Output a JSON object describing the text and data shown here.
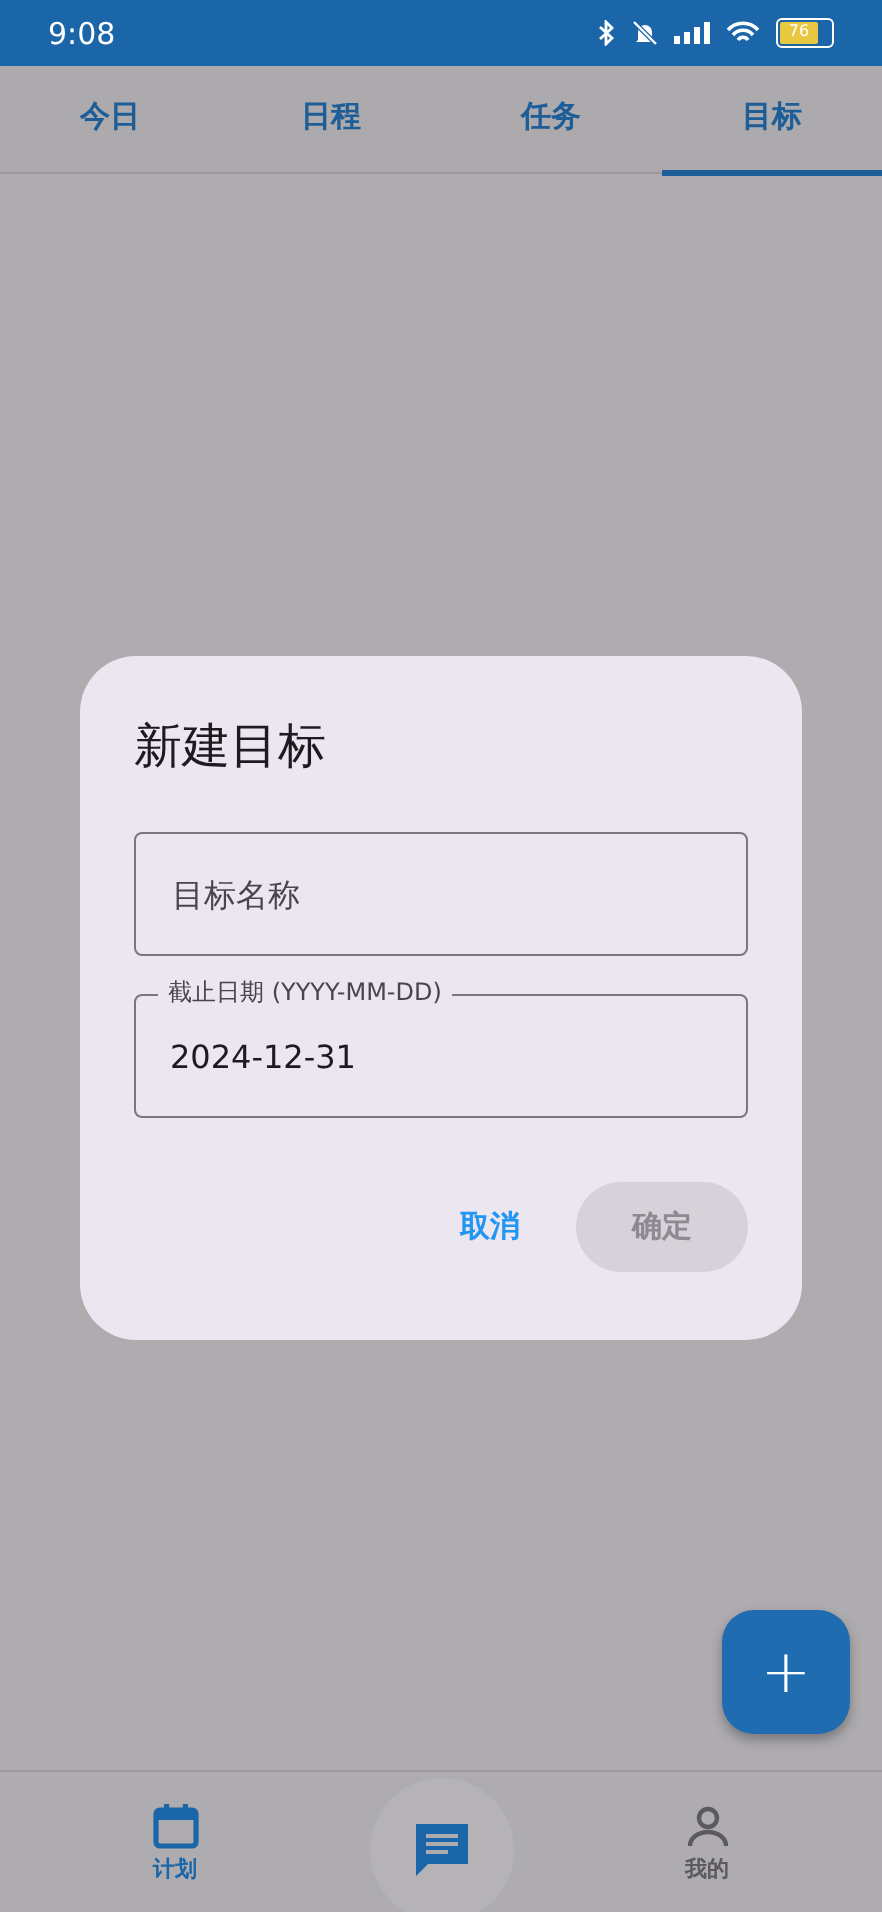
{
  "status_bar": {
    "time": "9:08",
    "battery": "76"
  },
  "tabs": [
    {
      "label": "今日",
      "selected": false
    },
    {
      "label": "日程",
      "selected": false
    },
    {
      "label": "任务",
      "selected": false
    },
    {
      "label": "目标",
      "selected": true
    }
  ],
  "dialog": {
    "title": "新建目标",
    "fields": [
      {
        "placeholder": "目标名称"
      },
      {
        "label": "截止日期 (YYYY-MM-DD)",
        "value": "2024-12-31"
      }
    ],
    "cancel": "取消",
    "confirm": {
      "label": "确定",
      "disabled": true
    }
  },
  "fab": {
    "label": "+"
  },
  "bottom_nav": [
    {
      "kind": "calendar",
      "label": "计划",
      "selected": true
    },
    {
      "kind": "chat",
      "selected": false
    },
    {
      "kind": "person",
      "label": "我的",
      "selected": false
    }
  ]
}
